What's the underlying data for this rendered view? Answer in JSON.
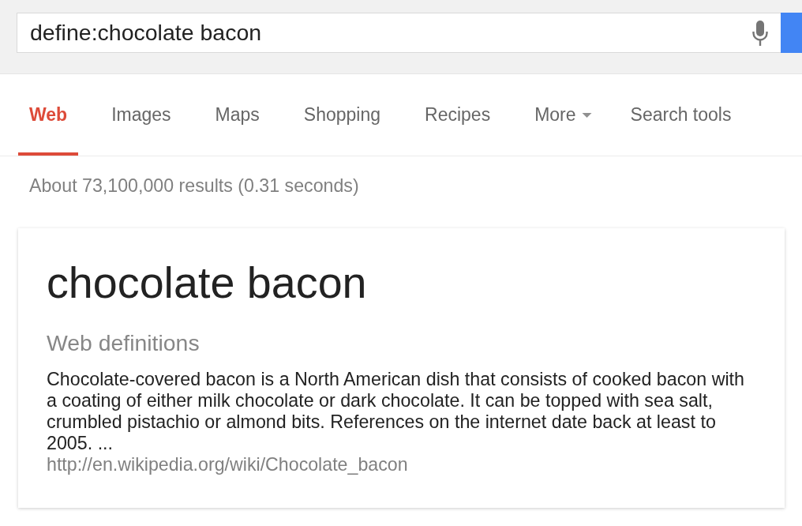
{
  "search": {
    "value": "define:chocolate bacon"
  },
  "tabs": [
    {
      "label": "Web",
      "selected": true,
      "kind": "tab"
    },
    {
      "label": "Images",
      "selected": false,
      "kind": "tab"
    },
    {
      "label": "Maps",
      "selected": false,
      "kind": "tab"
    },
    {
      "label": "Shopping",
      "selected": false,
      "kind": "tab"
    },
    {
      "label": "Recipes",
      "selected": false,
      "kind": "tab"
    },
    {
      "label": "More",
      "selected": false,
      "kind": "menu"
    },
    {
      "label": "Search tools",
      "selected": false,
      "kind": "tool"
    }
  ],
  "result_stats": "About 73,100,000 results (0.31 seconds)",
  "definition_card": {
    "term": "chocolate bacon",
    "section_title": "Web definitions",
    "definition": "Chocolate-covered bacon is a North American dish that consists of cooked bacon with a coating of either milk chocolate or dark chocolate. It can be topped with sea salt, crumbled pistachio or almond bits. References on the internet date back at least to 2005. ...",
    "source_url": "http://en.wikipedia.org/wiki/Chocolate_bacon"
  }
}
